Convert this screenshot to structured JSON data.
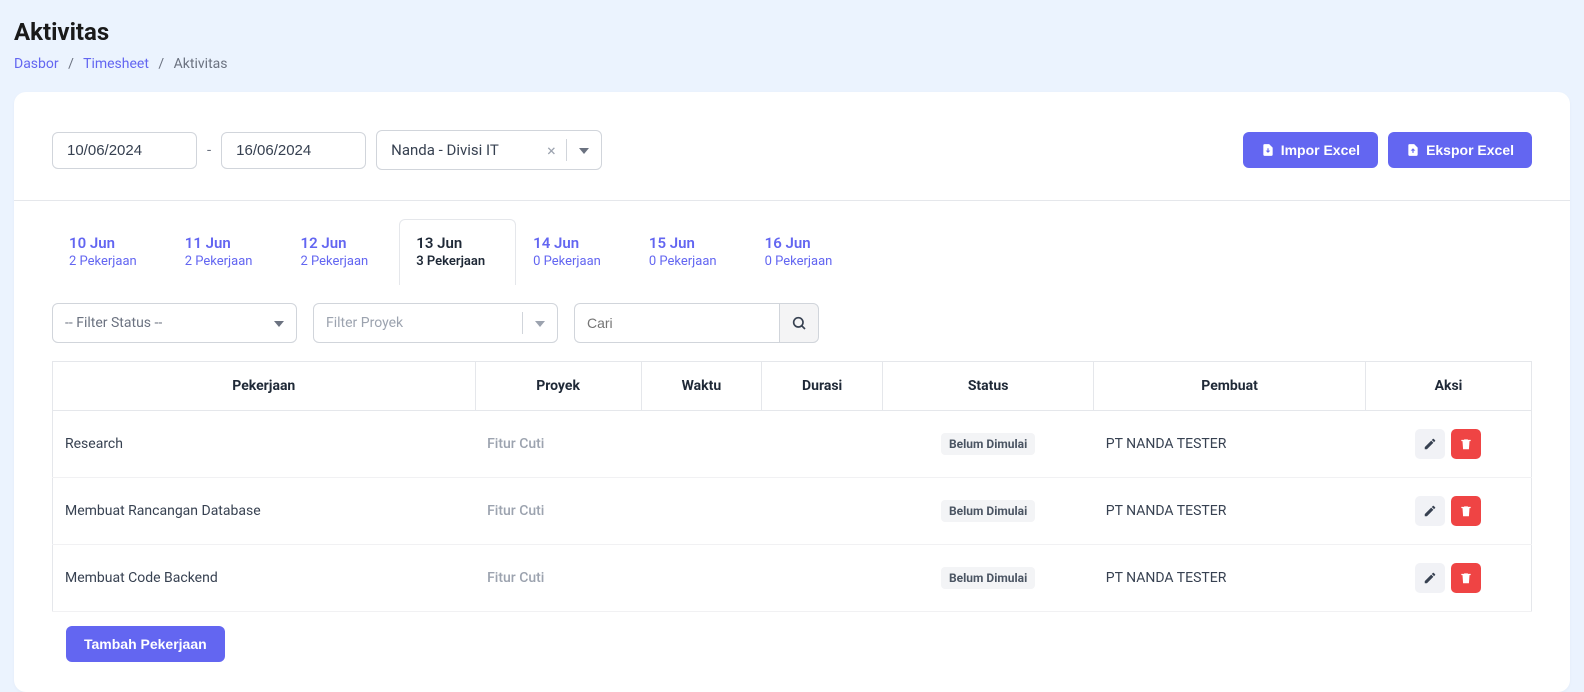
{
  "header": {
    "title": "Aktivitas",
    "breadcrumb": {
      "dasbor": "Dasbor",
      "timesheet": "Timesheet",
      "current": "Aktivitas"
    }
  },
  "filters": {
    "date_from": "10/06/2024",
    "date_to": "16/06/2024",
    "employee": "Nanda - Divisi IT",
    "import_label": "Impor Excel",
    "export_label": "Ekspor Excel"
  },
  "tabs": [
    {
      "date": "10 Jun",
      "sub": "2 Pekerjaan",
      "active": false
    },
    {
      "date": "11 Jun",
      "sub": "2 Pekerjaan",
      "active": false
    },
    {
      "date": "12 Jun",
      "sub": "2 Pekerjaan",
      "active": false
    },
    {
      "date": "13 Jun",
      "sub": "3 Pekerjaan",
      "active": true
    },
    {
      "date": "14 Jun",
      "sub": "0 Pekerjaan",
      "active": false
    },
    {
      "date": "15 Jun",
      "sub": "0 Pekerjaan",
      "active": false
    },
    {
      "date": "16 Jun",
      "sub": "0 Pekerjaan",
      "active": false
    }
  ],
  "subfilters": {
    "status_placeholder": "-- Filter Status --",
    "project_placeholder": "Filter Proyek",
    "search_placeholder": "Cari"
  },
  "table": {
    "columns": {
      "pekerjaan": "Pekerjaan",
      "proyek": "Proyek",
      "waktu": "Waktu",
      "durasi": "Durasi",
      "status": "Status",
      "pembuat": "Pembuat",
      "aksi": "Aksi"
    },
    "rows": [
      {
        "pekerjaan": "Research",
        "proyek": "Fitur Cuti",
        "waktu": "",
        "durasi": "",
        "status": "Belum Dimulai",
        "pembuat": "PT NANDA TESTER"
      },
      {
        "pekerjaan": "Membuat Rancangan Database",
        "proyek": "Fitur Cuti",
        "waktu": "",
        "durasi": "",
        "status": "Belum Dimulai",
        "pembuat": "PT NANDA TESTER"
      },
      {
        "pekerjaan": "Membuat Code Backend",
        "proyek": "Fitur Cuti",
        "waktu": "",
        "durasi": "",
        "status": "Belum Dimulai",
        "pembuat": "PT NANDA TESTER"
      }
    ]
  },
  "add_label": "Tambah Pekerjaan"
}
